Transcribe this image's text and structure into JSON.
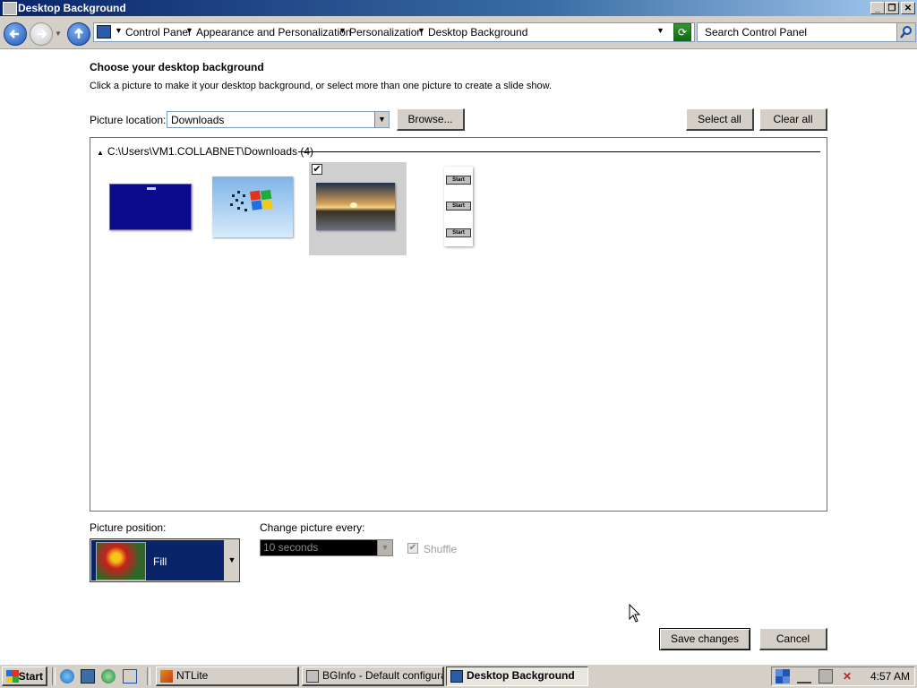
{
  "window": {
    "title": "Desktop Background",
    "minimize": "_",
    "restore": "❐",
    "close": "✕"
  },
  "address_bar": {
    "breadcrumbs": [
      "Control Panel",
      "Appearance and Personalization",
      "Personalization",
      "Desktop Background"
    ],
    "search_placeholder": "Search Control Panel"
  },
  "content": {
    "heading": "Choose your desktop background",
    "subheading": "Click a picture to make it your desktop background, or select more than one picture to create a slide show.",
    "picture_location_label": "Picture location:",
    "picture_location_value": "Downloads",
    "browse_label": "Browse...",
    "select_all_label": "Select all",
    "clear_all_label": "Clear all",
    "group_header": "C:\\Users\\VM1.COLLABNET\\Downloads (4)",
    "thumbnails": [
      {
        "name": "blue-screen",
        "selected": false
      },
      {
        "name": "windows-logo",
        "selected": false
      },
      {
        "name": "sunset-lake",
        "selected": true
      },
      {
        "name": "start-buttons",
        "selected": false
      }
    ],
    "start_thumb_label": "Start",
    "picture_position_label": "Picture position:",
    "picture_position_value": "Fill",
    "change_picture_label": "Change picture every:",
    "change_picture_value": "10 seconds",
    "shuffle_label": "Shuffle",
    "save_label": "Save changes",
    "cancel_label": "Cancel"
  },
  "taskbar": {
    "start_label": "Start",
    "tasks": [
      {
        "label": "NTLite",
        "active": false
      },
      {
        "label": "BGInfo - Default configura...",
        "active": false
      },
      {
        "label": "Desktop Background",
        "active": true
      }
    ],
    "clock": "4:57 AM"
  },
  "colors": {
    "titlebar": "#0a246a",
    "face": "#d4d0c8",
    "selection": "#0a246a"
  }
}
